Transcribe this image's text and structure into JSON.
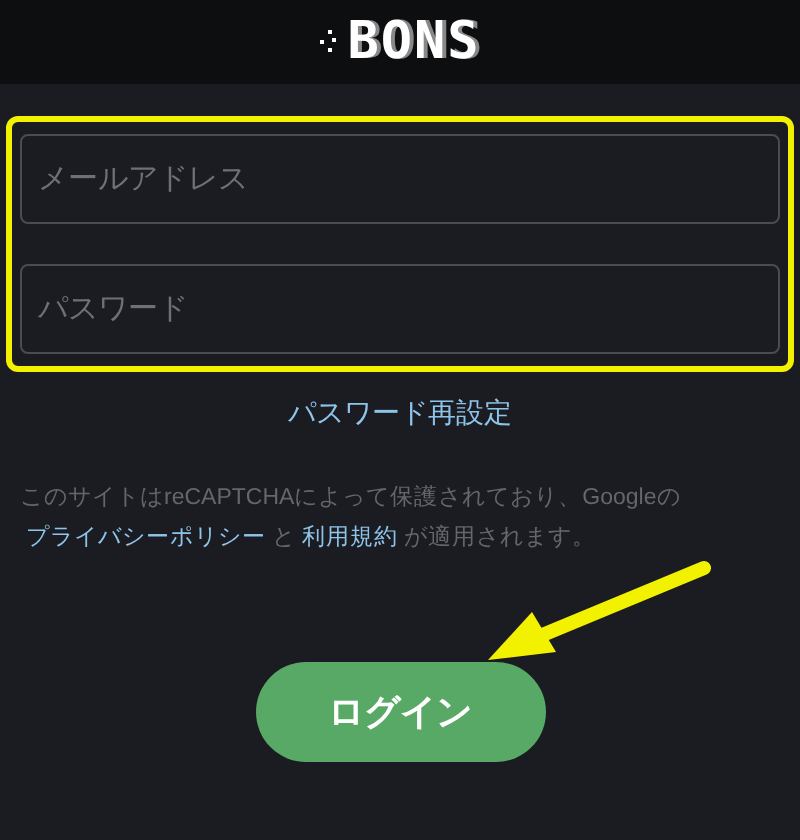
{
  "header": {
    "logo": "BONS"
  },
  "fields": [
    {
      "placeholder": "メールアドレス"
    },
    {
      "placeholder": "パスワード"
    }
  ],
  "reset_link": "パスワード再設定",
  "notice": [
    {
      "text": "このサイトはreCAPTCHAによって保護されており、Googleの",
      "kind": "plain"
    },
    {
      "text": "プライバシーポリシー",
      "kind": "link"
    },
    {
      "text": "と",
      "kind": "plain"
    },
    {
      "text": "利用規約",
      "kind": "link"
    },
    {
      "text": "が適用されます。",
      "kind": "plain"
    }
  ],
  "login_button": "ログイン"
}
